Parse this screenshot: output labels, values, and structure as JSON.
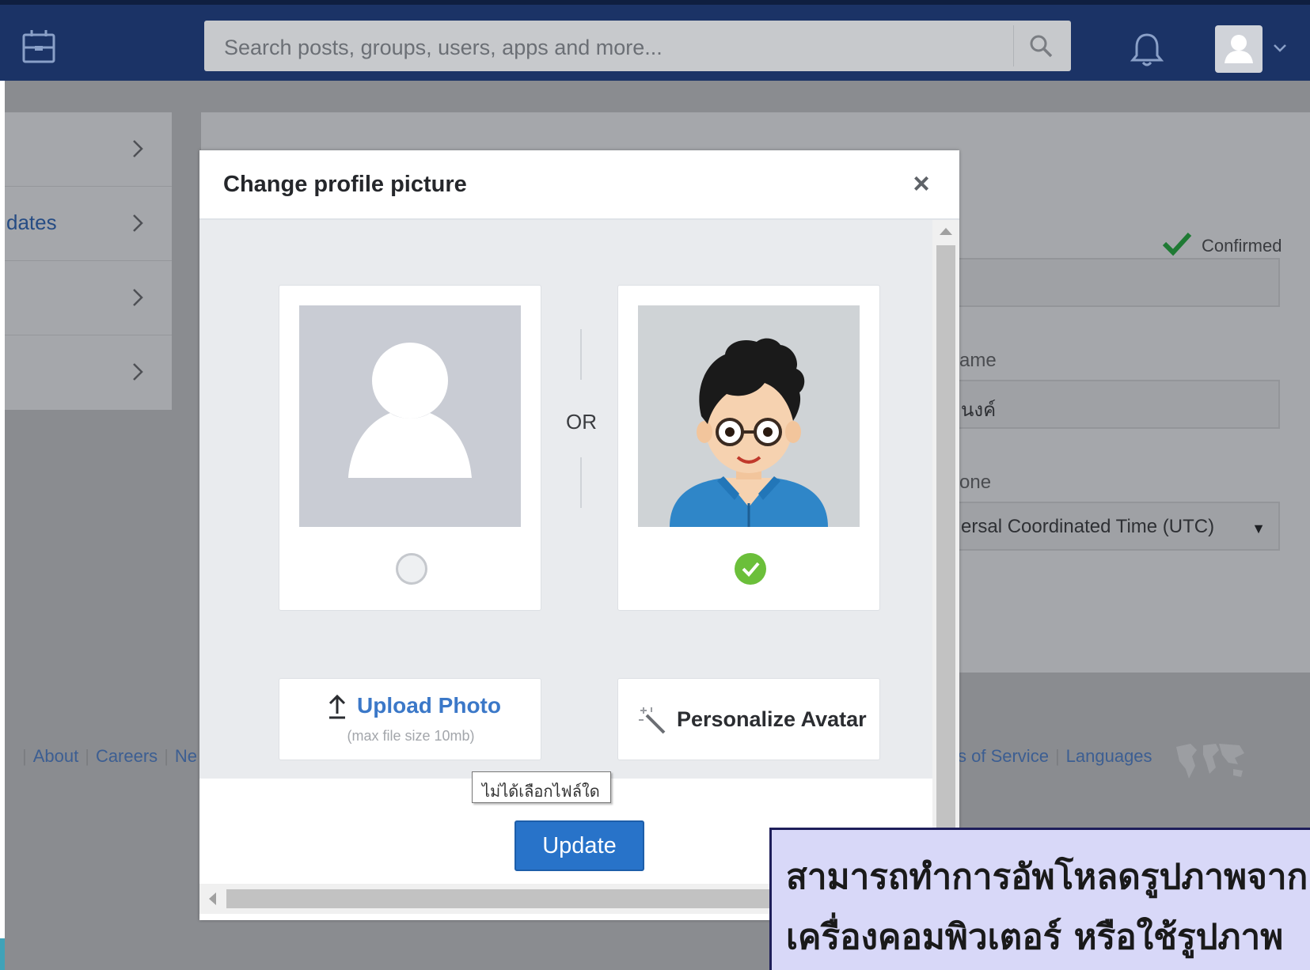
{
  "navbar": {
    "logo_icon": "inbox-tray-icon",
    "search_placeholder": "Search posts, groups, users, apps and more...",
    "search_icon": "search-icon",
    "bell_icon": "bell-icon",
    "avatar_icon": "user-avatar-icon",
    "avatar_caret_icon": "chevron-down-icon"
  },
  "sidebar": {
    "items": [
      {
        "label": ""
      },
      {
        "label": "dates"
      },
      {
        "label": ""
      },
      {
        "label": ""
      }
    ]
  },
  "settings": {
    "confirmed_label": "Confirmed",
    "name_label": "ame",
    "name_value": "นงค์",
    "timezone_label": "one",
    "timezone_value": "ersal Coordinated Time (UTC)"
  },
  "footer": {
    "left_links": [
      "About",
      "Careers",
      "Ne"
    ],
    "right_links": [
      "s of Service",
      "Languages"
    ]
  },
  "modal": {
    "title": "Change profile picture",
    "close_label": "×",
    "or_label": "OR",
    "upload_label": "Upload Photo",
    "upload_hint": "(max file size 10mb)",
    "no_file_tooltip": "ไม่ได้เลือกไฟล์ใด",
    "avatar_label": "Personalize Avatar",
    "update_label": "Update",
    "selected_option": "avatar"
  },
  "caption": {
    "line1": "สามารถทำการอัพโหลดรูปภาพจาก",
    "line2": "เครื่องคอมพิวเตอร์ หรือใช้รูปภาพ"
  },
  "colors": {
    "navbar": "#1b3366",
    "accent": "#2873c9",
    "link": "#3b78c8",
    "success": "#6bbf3a"
  }
}
